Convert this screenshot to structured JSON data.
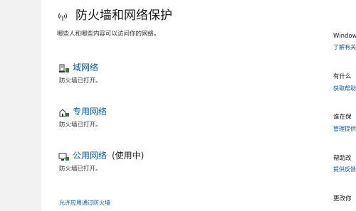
{
  "header": {
    "title": "防火墙和网络保护",
    "subtitle": "哪些人和哪些内容可以访问你的网络。",
    "icon": "antenna-signal-icon"
  },
  "networks": [
    {
      "name": "域网络",
      "status": "防火墙已打开。",
      "active_label": "",
      "icon": "domain-network-icon"
    },
    {
      "name": "专用网络",
      "status": "防火墙已打开。",
      "active_label": "",
      "icon": "private-network-icon"
    },
    {
      "name": "公用网络",
      "status": "防火墙已打开。",
      "active_label": "(使用中)",
      "icon": "public-network-icon"
    }
  ],
  "links": {
    "allow_app": "允许应用通过防火墙"
  },
  "right_panel": {
    "sections": [
      {
        "title": "Window",
        "link": "了解有关"
      },
      {
        "title": "有什么",
        "link": "获取帮助"
      },
      {
        "title": "谁在保",
        "link": "管理提供"
      },
      {
        "title": "帮助改",
        "link": "提供反馈"
      },
      {
        "title": "更改你",
        "link": ""
      }
    ]
  },
  "colors": {
    "link": "#0b5aa3",
    "icon_green": "#2e7d32",
    "rail": "#f2f2f2"
  }
}
